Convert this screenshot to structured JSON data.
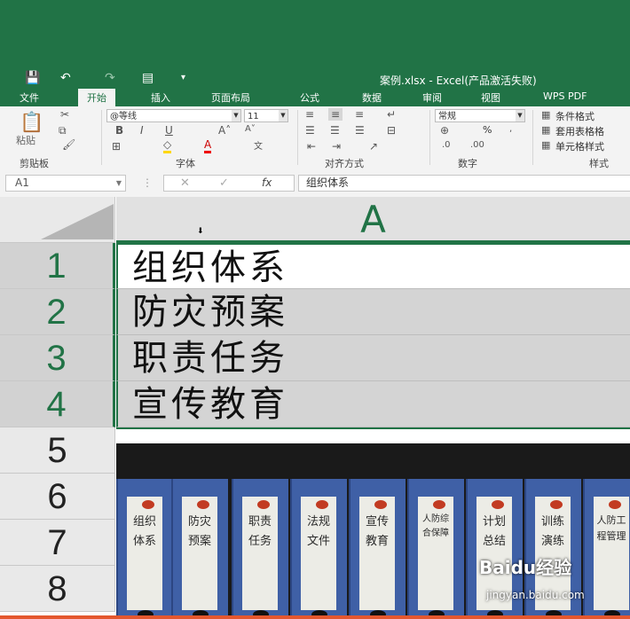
{
  "window": {
    "title": "案例.xlsx - Excel(产品激活失败)"
  },
  "tabs": [
    {
      "label": "文件"
    },
    {
      "label": "开始",
      "active": true
    },
    {
      "label": "插入"
    },
    {
      "label": "页面布局"
    },
    {
      "label": "公式"
    },
    {
      "label": "数据"
    },
    {
      "label": "审阅"
    },
    {
      "label": "视图"
    },
    {
      "label": "WPS PDF"
    }
  ],
  "ribbon": {
    "paste_label": "粘贴",
    "font_name": "@等线",
    "font_size": "11",
    "number_format": "常规",
    "percent": "%",
    "conditional_format": "条件格式",
    "table_format": "套用表格格",
    "cell_style": "单元格样式",
    "groups": [
      "剪贴板",
      "字体",
      "对齐方式",
      "数字",
      "样式"
    ]
  },
  "formula_bar": {
    "name_box": "A1",
    "formula": "组织体系",
    "fx": "fx"
  },
  "grid": {
    "column_header": "A",
    "row_numbers": [
      "1",
      "2",
      "3",
      "4",
      "5",
      "6",
      "7",
      "8"
    ],
    "cells": [
      "组织体系",
      "防灾预案",
      "职责任务",
      "宣传教育"
    ]
  },
  "photo": {
    "binder_labels": [
      "组织体系",
      "防灾预案",
      "职责任务",
      "法规文件",
      "宣传教育",
      "人防综合保障",
      "计划总结",
      "训练演练",
      "人防工程管理"
    ]
  },
  "watermark": {
    "main": "Baidu经验",
    "sub": "jingyan.baidu.com"
  },
  "colors": {
    "excel_green": "#217346",
    "ribbon_bg": "#f3f3f3",
    "selection_grey": "#d4d4d4"
  }
}
